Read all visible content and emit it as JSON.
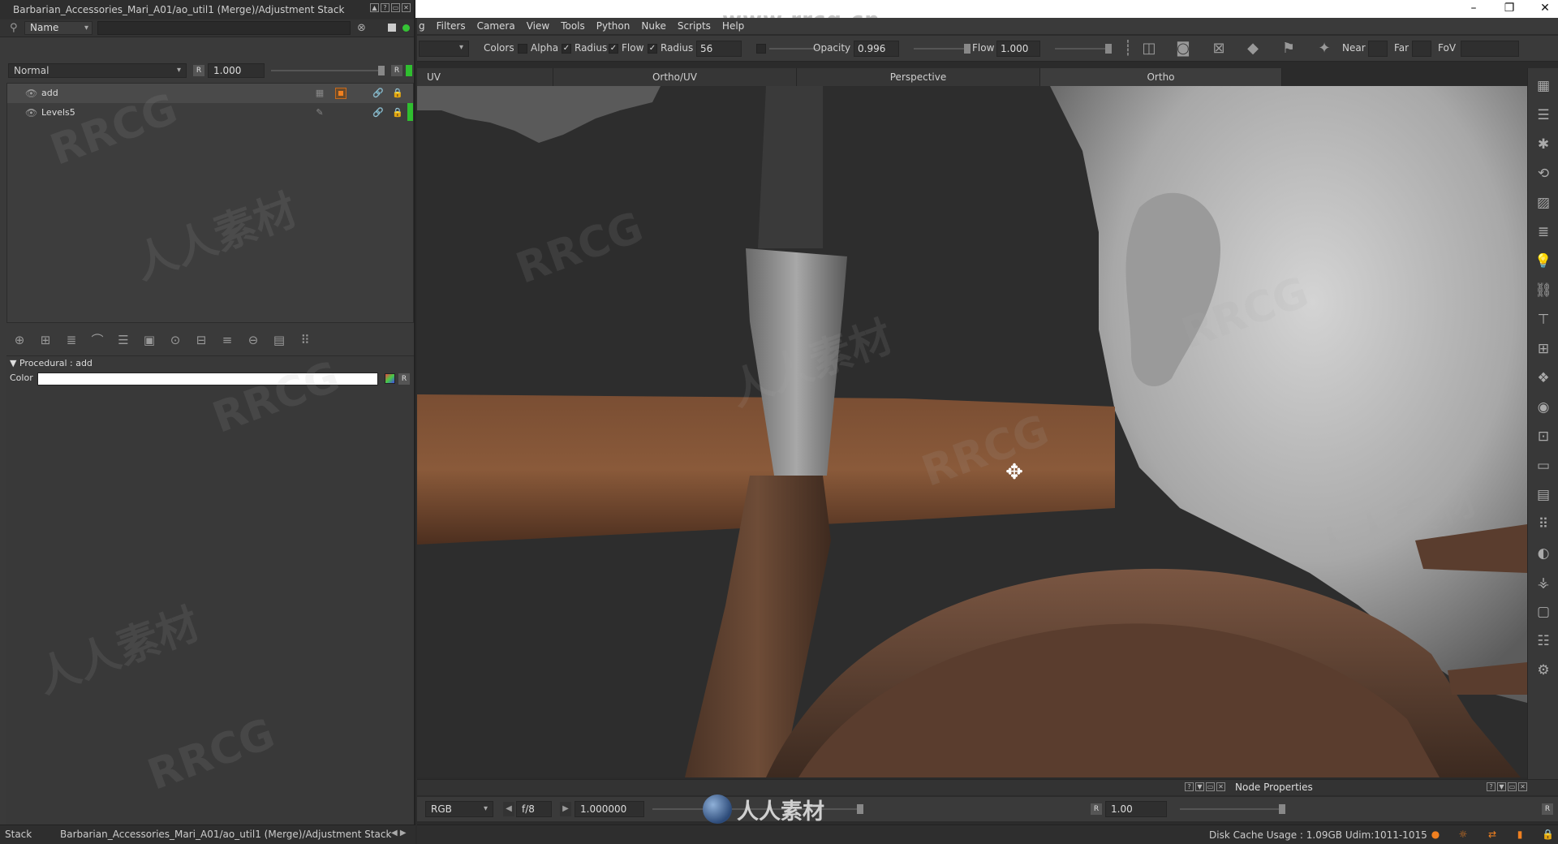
{
  "window": {
    "minimize": "–",
    "restore": "❐",
    "close": "✕"
  },
  "left_panel": {
    "title": "Barbarian_Accessories_Mari_A01/ao_util1 (Merge)/Adjustment Stack",
    "search": {
      "field_label": "Name",
      "placeholder": ""
    },
    "blend_mode": "Normal",
    "opacity_label": "R",
    "opacity_value": "1.000",
    "r_button": "R",
    "layers": [
      {
        "name": "add",
        "selected": true
      },
      {
        "name": "Levels5",
        "selected": false
      }
    ],
    "procedural": {
      "header": "Procedural : add",
      "color_label": "Color",
      "color_value": "#ffffff",
      "r_button": "R"
    },
    "status": {
      "tab": "Stack",
      "path": "Barbarian_Accessories_Mari_A01/ao_util1 (Merge)/Adjustment Stack"
    }
  },
  "menu": {
    "items": [
      "g",
      "Filters",
      "Camera",
      "View",
      "Tools",
      "Python",
      "Nuke",
      "Scripts",
      "Help"
    ]
  },
  "watermark_url": "www.rrcg.cn",
  "toolbar": {
    "colors_label": "Colors",
    "alpha_label": "Alpha",
    "radius_check_label": "Radius",
    "flow_check_label": "Flow",
    "radius_label": "Radius",
    "radius_value": "56",
    "opacity_label": "Opacity",
    "opacity_value": "0.996",
    "flow_label": "Flow",
    "flow_value": "1.000",
    "near_label": "Near",
    "far_label": "Far",
    "fov_label": "FoV"
  },
  "view_tabs": [
    "UV",
    "Ortho/UV",
    "Perspective",
    "Ortho"
  ],
  "node_properties": {
    "title": "Node Properties"
  },
  "viewer": {
    "channel": "RGB",
    "fstop": "f/8",
    "exposure": "1.000000",
    "r_label": "R",
    "gain": "1.00",
    "r_right": "R"
  },
  "watermark_logo_text": "人人素材",
  "status_bar": {
    "disk_cache": "Disk Cache Usage : 1.09GB  Udim:1011-1015"
  },
  "overlay_watermarks": [
    "RRCG",
    "人人素材"
  ],
  "colors": {
    "active_green": "#2fbf2f",
    "orange_accent": "#f08020"
  }
}
